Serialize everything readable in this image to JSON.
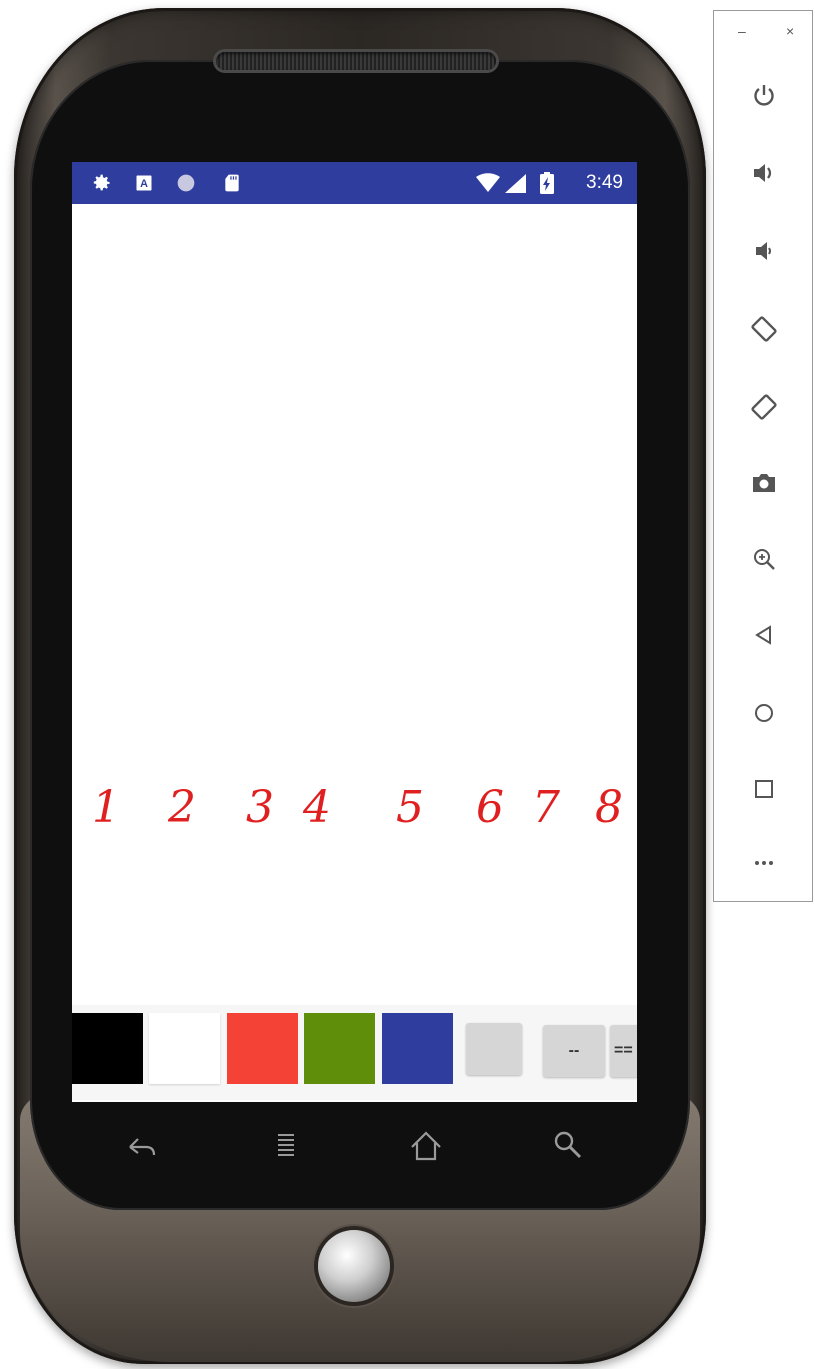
{
  "status_bar": {
    "time": "3:49",
    "icons": [
      "settings-icon",
      "a-box-icon",
      "circle-icon",
      "sd-card-icon",
      "wifi-icon",
      "signal-icon",
      "battery-charging-icon"
    ],
    "background": "#2f3d9f"
  },
  "annotations": {
    "digits": [
      "1",
      "2",
      "3",
      "4",
      "5",
      "6",
      "7",
      "8"
    ],
    "color": "#e02020"
  },
  "toolbar": {
    "swatches": [
      {
        "name": "black",
        "color": "#000000"
      },
      {
        "name": "white",
        "color": "#ffffff"
      },
      {
        "name": "red",
        "color": "#f44336"
      },
      {
        "name": "green",
        "color": "#5f8f0a"
      },
      {
        "name": "blue",
        "color": "#2f3d9f"
      }
    ],
    "small_button_label": "",
    "dash_button_label": "--",
    "double_dash_label": "=="
  },
  "nav_bar": {
    "icons": [
      "back-icon",
      "menu-icon",
      "home-icon",
      "search-icon"
    ]
  },
  "emulator_panel": {
    "window_controls": [
      "minimize-icon",
      "close-icon"
    ],
    "minimize_label": "–",
    "close_label": "×",
    "buttons": [
      "power-icon",
      "volume-up-icon",
      "volume-down-icon",
      "rotate-left-icon",
      "rotate-right-icon",
      "camera-icon",
      "zoom-icon",
      "back-triangle-icon",
      "home-circle-icon",
      "overview-square-icon",
      "more-icon"
    ]
  }
}
